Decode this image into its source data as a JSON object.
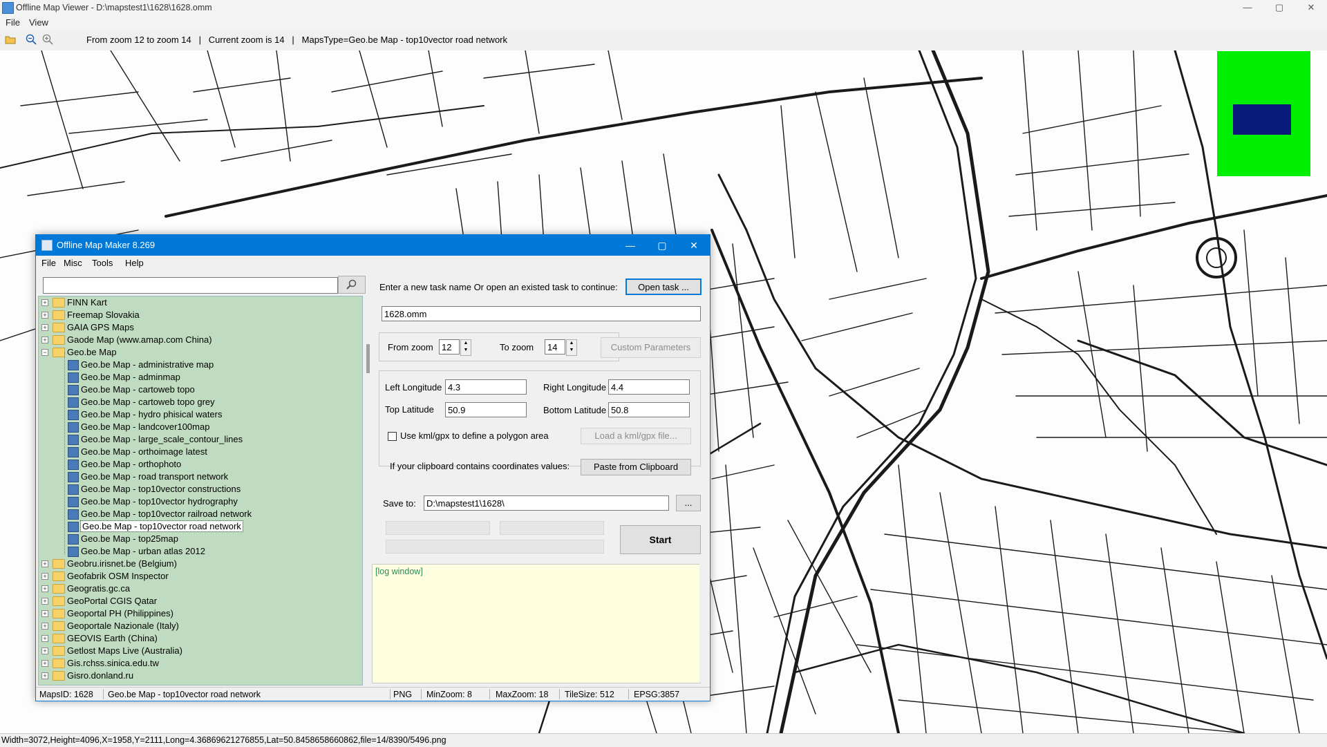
{
  "window": {
    "title": "Offline Map Viewer - D:\\mapstest1\\1628\\1628.omm",
    "controls": {
      "minimize": "—",
      "maximize": "▢",
      "close": "✕"
    }
  },
  "menu": {
    "file": "File",
    "view": "View"
  },
  "toolbar": {
    "info": "From zoom 12 to zoom 14   |   Current zoom is 14   |   MapsType=Geo.be Map - top10vector road network",
    "icons": [
      "open-folder-icon",
      "zoom-out-icon",
      "zoom-in-icon"
    ]
  },
  "minimap": {
    "background": "#00ee00",
    "viewport_color": "#0a1a7a"
  },
  "statusbar": "Width=3072,Height=4096,X=1958,Y=2111,Long=4.36869621276855,Lat=50.8458658660862,file=14/8390/5496.png",
  "dialog": {
    "title": "Offline Map Maker 8.269",
    "menu": [
      "File",
      "Misc",
      "Tools",
      "Help"
    ],
    "search": {
      "value": "",
      "placeholder": ""
    },
    "tree": [
      {
        "label": "FINN Kart",
        "type": "folder",
        "expanded": false
      },
      {
        "label": "Freemap Slovakia",
        "type": "folder",
        "expanded": false
      },
      {
        "label": "GAIA GPS Maps",
        "type": "folder",
        "expanded": false
      },
      {
        "label": "Gaode Map (www.amap.com China)",
        "type": "folder",
        "expanded": false
      },
      {
        "label": "Geo.be Map",
        "type": "folder",
        "expanded": true
      },
      {
        "label": "Geo.be Map - administrative map",
        "type": "map"
      },
      {
        "label": "Geo.be Map - adminmap",
        "type": "map"
      },
      {
        "label": "Geo.be Map - cartoweb topo",
        "type": "map"
      },
      {
        "label": "Geo.be Map - cartoweb topo grey",
        "type": "map"
      },
      {
        "label": "Geo.be Map - hydro phisical waters",
        "type": "map"
      },
      {
        "label": "Geo.be Map - landcover100map",
        "type": "map"
      },
      {
        "label": "Geo.be Map - large_scale_contour_lines",
        "type": "map"
      },
      {
        "label": "Geo.be Map - orthoimage latest",
        "type": "map"
      },
      {
        "label": "Geo.be Map - orthophoto",
        "type": "map"
      },
      {
        "label": "Geo.be Map - road transport network",
        "type": "map"
      },
      {
        "label": "Geo.be Map - top10vector constructions",
        "type": "map"
      },
      {
        "label": "Geo.be Map - top10vector hydrography",
        "type": "map"
      },
      {
        "label": "Geo.be Map - top10vector railroad network",
        "type": "map"
      },
      {
        "label": "Geo.be Map - top10vector road network",
        "type": "map",
        "selected": true
      },
      {
        "label": "Geo.be Map - top25map",
        "type": "map"
      },
      {
        "label": "Geo.be Map - urban atlas 2012",
        "type": "map"
      },
      {
        "label": "Geobru.irisnet.be (Belgium)",
        "type": "folder",
        "expanded": false
      },
      {
        "label": "Geofabrik OSM Inspector",
        "type": "folder",
        "expanded": false
      },
      {
        "label": "Geogratis.gc.ca",
        "type": "folder",
        "expanded": false
      },
      {
        "label": "GeoPortal CGIS Qatar",
        "type": "folder",
        "expanded": false
      },
      {
        "label": "Geoportal PH (Philippines)",
        "type": "folder",
        "expanded": false
      },
      {
        "label": "Geoportale Nazionale (Italy)",
        "type": "folder",
        "expanded": false
      },
      {
        "label": "GEOVIS Earth (China)",
        "type": "folder",
        "expanded": false
      },
      {
        "label": "Getlost Maps Live (Australia)",
        "type": "folder",
        "expanded": false
      },
      {
        "label": "Gis.rchss.sinica.edu.tw",
        "type": "folder",
        "expanded": false
      },
      {
        "label": "Gisro.donland.ru",
        "type": "folder",
        "expanded": false
      }
    ],
    "task_prompt": "Enter a new task name Or open an existed task to continue:",
    "open_task": "Open task ...",
    "task_name": "1628.omm",
    "from_zoom_label": "From zoom",
    "from_zoom": "12",
    "to_zoom_label": "To zoom",
    "to_zoom": "14",
    "custom_params": "Custom Parameters",
    "left_lon_label": "Left Longitude",
    "left_lon": "4.3",
    "right_lon_label": "Right Longitude",
    "right_lon": "4.4",
    "top_lat_label": "Top Latitude",
    "top_lat": "50.9",
    "bottom_lat_label": "Bottom Latitude",
    "bottom_lat": "50.8",
    "kml_label": "Use kml/gpx to define a polygon area",
    "kml_checked": false,
    "load_kml": "Load a kml/gpx file...",
    "clipboard_label": "If your clipboard contains coordinates values:",
    "paste_btn": "Paste from Clipboard",
    "save_label": "Save to:",
    "save_path": "D:\\mapstest1\\1628\\",
    "browse": "...",
    "start": "Start",
    "log": "[log window]",
    "status": {
      "mapsid": "MapsID: 1628",
      "name": "Geo.be Map - top10vector road network",
      "format": "PNG",
      "minzoom": "MinZoom: 8",
      "maxzoom": "MaxZoom: 18",
      "tilesize": "TileSize: 512",
      "epsg": "EPSG:3857"
    }
  }
}
